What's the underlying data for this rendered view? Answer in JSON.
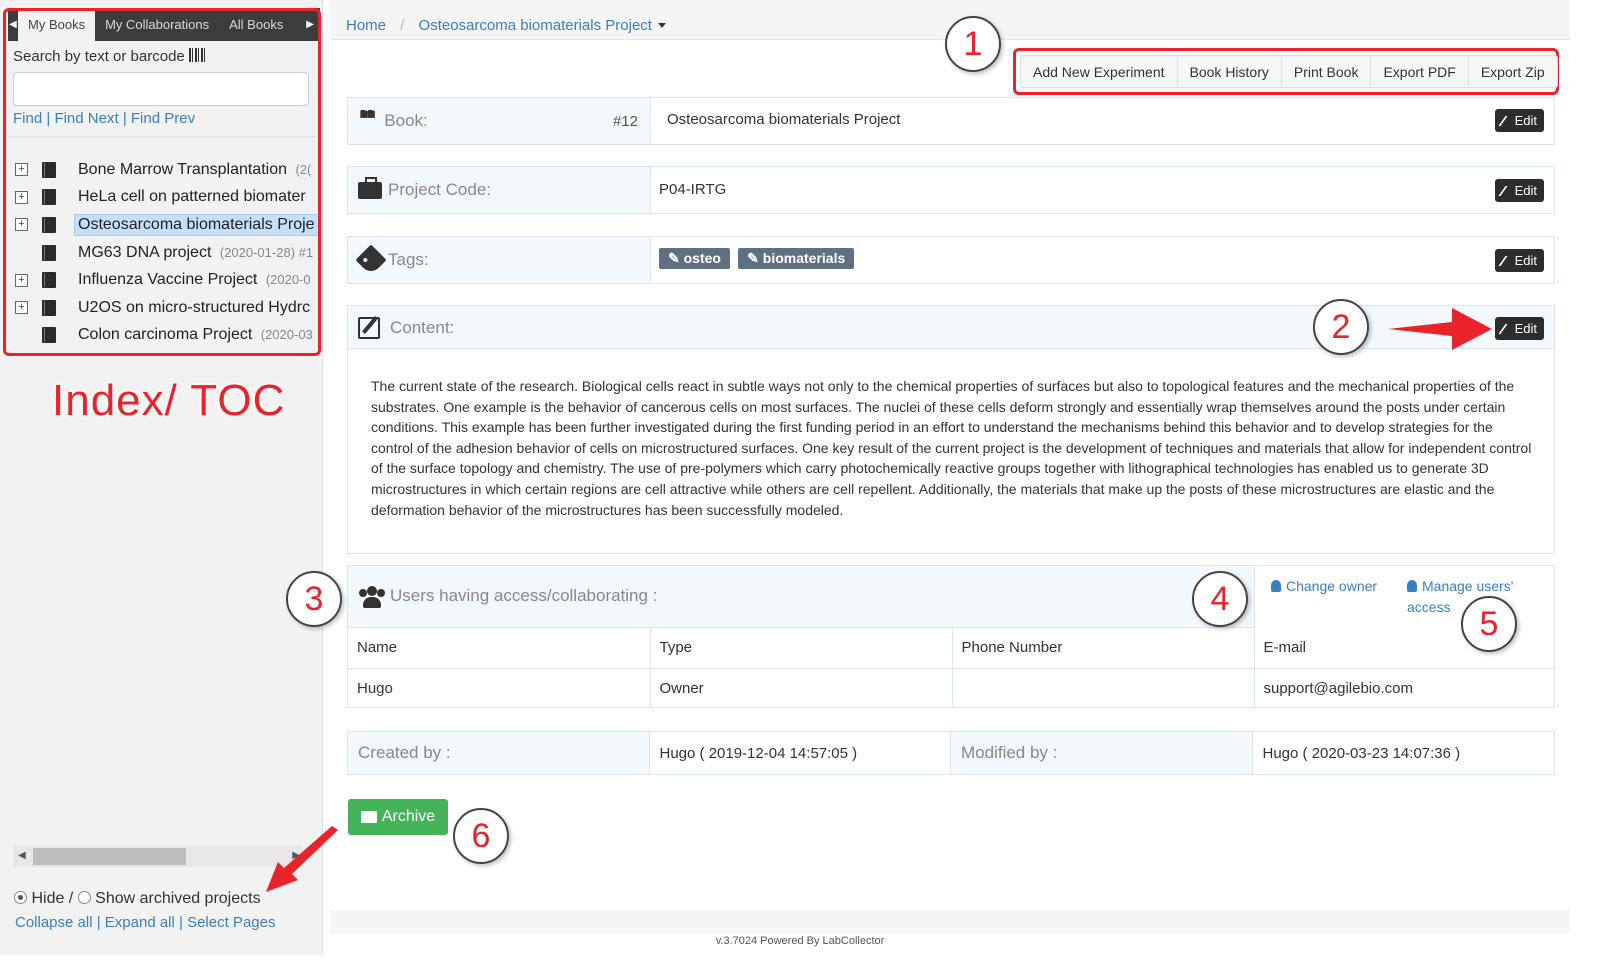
{
  "sidebar": {
    "tabs": [
      "My Books",
      "My Collaborations",
      "All Books"
    ],
    "search_label": "Search by text or barcode",
    "find_links": [
      "Find",
      "Find Next",
      "Find Prev"
    ],
    "books": [
      {
        "title": "Bone Marrow Transplantation",
        "meta": "(2(",
        "expandable": true,
        "selected": false
      },
      {
        "title": "HeLa cell on patterned biomater",
        "meta": "",
        "expandable": true,
        "selected": false
      },
      {
        "title": "Osteosarcoma biomaterials Proje",
        "meta": "",
        "expandable": true,
        "selected": true
      },
      {
        "title": "MG63 DNA project",
        "meta": "(2020-01-28) #1",
        "expandable": false,
        "selected": false
      },
      {
        "title": "Influenza Vaccine Project",
        "meta": "(2020-0",
        "expandable": true,
        "selected": false
      },
      {
        "title": "U2OS on micro-structured Hydrc",
        "meta": "",
        "expandable": true,
        "selected": false
      },
      {
        "title": "Colon carcinoma Project",
        "meta": "(2020-03",
        "expandable": false,
        "selected": false
      }
    ],
    "annotation": "Index/ TOC",
    "archived_hide": "Hide /",
    "archived_show": "Show archived projects",
    "tree_links": [
      "Collapse all",
      "Expand all",
      "Select Pages"
    ]
  },
  "breadcrumb": {
    "home": "Home",
    "current": "Osteosarcoma biomaterials Project"
  },
  "actions": [
    "Add New Experiment",
    "Book History",
    "Print Book",
    "Export PDF",
    "Export Zip"
  ],
  "book": {
    "label": "Book:",
    "number": "#12",
    "title": "Osteosarcoma biomaterials Project"
  },
  "project_code": {
    "label": "Project Code:",
    "value": "P04-IRTG"
  },
  "tags": {
    "label": "Tags:",
    "items": [
      "osteo",
      "biomaterials"
    ]
  },
  "content": {
    "label": "Content:",
    "text": "The current state of the research. Biological cells react in subtle ways not only to the chemical properties of surfaces but also to topological features and the mechanical properties of the substrates. One example is the behavior of cancerous cells on most surfaces. The nuclei of these cells deform strongly and essentially wrap themselves around the posts under certain conditions. This example has been further investigated during the first funding period in an effort to understand the mechanisms behind this behavior and to develop strategies for the control of the adhesion behavior of cells on microstructured surfaces. One key result of the current project is the development of techniques and materials that allow for independent control of the surface topology and chemistry. The use of pre-polymers which carry photochemically reactive groups together with lithographical technologies has enabled us to generate 3D microstructures in which certain regions are cell attractive while others are cell repellent. Additionally, the materials that make up the posts of these microstructures are elastic and the deformation behavior of the microstructures has been successfully modeled."
  },
  "edit_label": "Edit",
  "users": {
    "label": "Users having access/collaborating :",
    "change_owner": "Change owner",
    "manage_access_1": "Manage users'",
    "manage_access_2": "access",
    "columns": [
      "Name",
      "Type",
      "Phone Number",
      "E-mail"
    ],
    "rows": [
      [
        "Hugo",
        "Owner",
        "",
        "support@agilebio.com"
      ]
    ]
  },
  "meta": {
    "created_label": "Created by :",
    "created_value": "Hugo ( 2019-12-04 14:57:05 )",
    "modified_label": "Modified by :",
    "modified_value": "Hugo ( 2020-03-23 14:07:36 )"
  },
  "archive_label": "Archive",
  "footer": "v.3.7024 Powered By LabCollector",
  "callouts": [
    "1",
    "2",
    "3",
    "4",
    "5",
    "6"
  ],
  "colors": {
    "annotation_red": "#e8232a",
    "link_blue": "#3a7fc1",
    "archive_green": "#45b35a",
    "tag_gray": "#5f7080"
  }
}
